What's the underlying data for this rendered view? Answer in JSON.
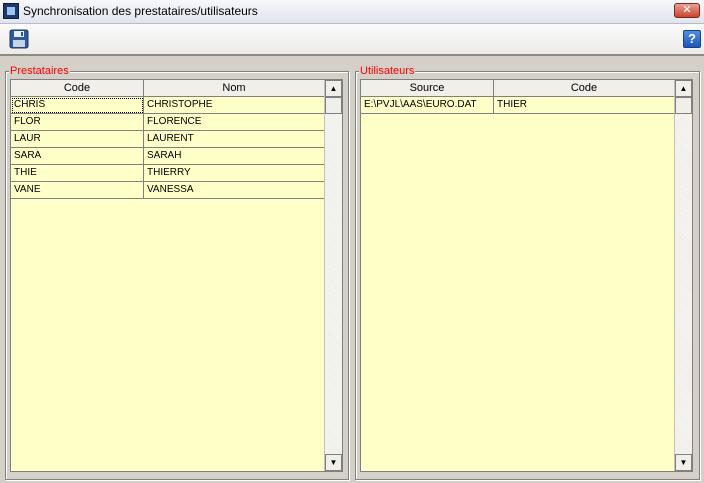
{
  "window": {
    "title": "Synchronisation des prestataires/utilisateurs",
    "close_glyph": "✕"
  },
  "toolbar": {
    "save_icon": "floppy-disk-icon",
    "help_icon": "help-icon",
    "help_glyph": "?"
  },
  "prestataires": {
    "legend": "Prestataires",
    "columns": [
      "Code",
      "Nom"
    ],
    "rows": [
      [
        "CHRIS",
        "CHRISTOPHE"
      ],
      [
        "FLOR",
        "FLORENCE"
      ],
      [
        "LAUR",
        "LAURENT"
      ],
      [
        "SARA",
        "SARAH"
      ],
      [
        "THIE",
        "THIERRY"
      ],
      [
        "VANE",
        "VANESSA"
      ]
    ]
  },
  "utilisateurs": {
    "legend": "Utilisateurs",
    "columns": [
      "Source",
      "Code"
    ],
    "rows": [
      [
        "E:\\PVJL\\AAS\\EURO.DAT",
        "THIER"
      ]
    ]
  },
  "scroll": {
    "up": "▲",
    "down": "▼"
  },
  "colors": {
    "grid_bg": "#ffffc8",
    "legend": "#ff0000",
    "dialog_bg": "#d4d0c8"
  }
}
